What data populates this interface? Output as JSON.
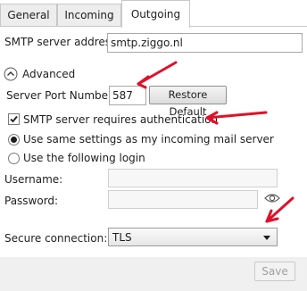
{
  "tabs": [
    {
      "label": "General",
      "active": false
    },
    {
      "label": "Incoming",
      "active": false
    },
    {
      "label": "Outgoing",
      "active": true
    }
  ],
  "smtp": {
    "label": "SMTP server address",
    "value": "smtp.ziggo.nl"
  },
  "advanced": {
    "label": "Advanced",
    "expanded": true
  },
  "port": {
    "label": "Server Port Number:",
    "value": "587",
    "restore_label": "Restore Default"
  },
  "auth": {
    "label": "SMTP server requires authentication",
    "checked": true
  },
  "login_options": [
    {
      "label": "Use same settings as my incoming mail server",
      "selected": true
    },
    {
      "label": "Use the following login",
      "selected": false
    }
  ],
  "username": {
    "label": "Username:",
    "value": ""
  },
  "password": {
    "label": "Password:",
    "value": ""
  },
  "secure": {
    "label": "Secure connection:",
    "value": "TLS"
  },
  "footer": {
    "save_label": "Save"
  },
  "colors": {
    "annotation_arrow": "#e0102a",
    "tab_border": "#c8c8c8",
    "footer_bg": "#f0f0f0"
  },
  "icons": {
    "advanced_toggle": "chevron-up-icon",
    "checkbox": "checkmark-icon",
    "password_toggle": "eye-icon",
    "dropdown": "caret-down-icon",
    "annotation": "arrow-icon"
  }
}
